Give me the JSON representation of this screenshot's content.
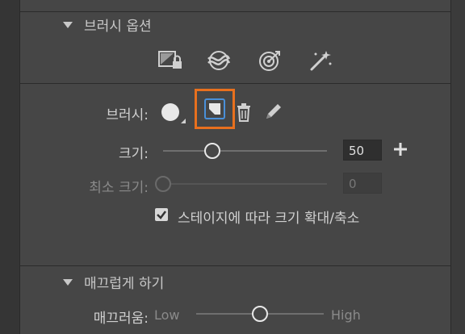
{
  "brush_options": {
    "title": "브러시 옵션",
    "tool_icons": [
      "lock-fill-icon",
      "smooth-icon",
      "target-icon",
      "magic-wand-icon"
    ],
    "brush_label": "브러시:",
    "size": {
      "label": "크기:",
      "value": "50",
      "fraction": 0.3
    },
    "min_size": {
      "label": "최소 크기:",
      "value": "0",
      "disabled": true
    },
    "scale_with_stage": {
      "label": "스테이지에 따라 크기 확대/축소",
      "checked": true
    }
  },
  "smoothing": {
    "title": "매끄럽게 하기",
    "label": "매끄러움:",
    "low": "Low",
    "high": "High",
    "fraction": 0.5
  },
  "colors": {
    "accent": "#e8701e",
    "panel": "#464646"
  }
}
